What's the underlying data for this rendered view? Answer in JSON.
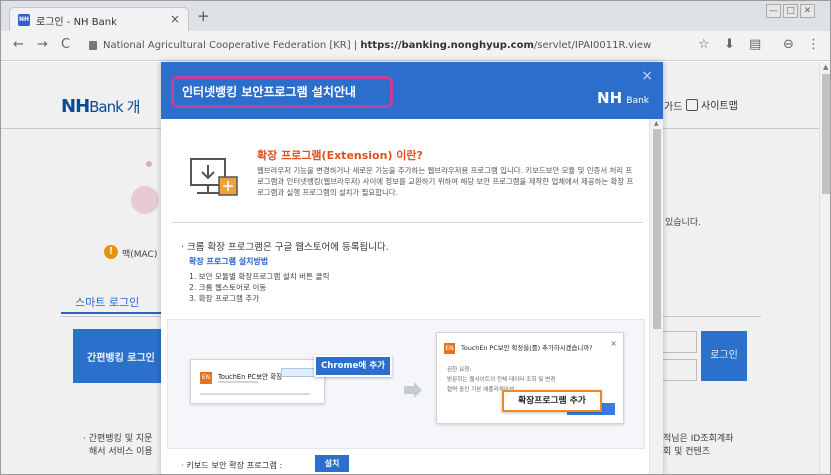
{
  "browser": {
    "tab_title": "로그인 - NH Bank",
    "tab_close": "×",
    "new_tab": "+",
    "url_prefix": "National Agricultural Cooperative Federation [KR]",
    "url_separator": "|",
    "url_host": "https://banking.nonghyup.com",
    "url_path": "/servlet/IPAI0011R.view",
    "back": "←",
    "forward": "→",
    "reload": "C",
    "star": "☆",
    "download": "⬇",
    "extensions": "▤",
    "profile": "⊖",
    "menu": "⋮",
    "win_min": "—",
    "win_max": "□",
    "win_close": "✕"
  },
  "page": {
    "logo_main": "NH",
    "logo_sub": "Bank 개",
    "header_partial": "가드",
    "sitemap_label": "사이트맵",
    "notice_partial": "있습니다.",
    "mac_partial": "맥(MAC)",
    "smart_login_tab": "스마트 로그인",
    "easy_banking_button": "간편뱅킹 로그인",
    "login_button": "로그인",
    "footer_left_1": "· 간편뱅킹 및 지문",
    "footer_left_2": "해서 서비스 이용",
    "footer_right_1": "적님은 ID조회계좌",
    "footer_right_2": "회 및 컨텐츠"
  },
  "modal": {
    "title": "인터넷뱅킹 보안프로그램 설치안내",
    "brand": "NH",
    "brand_sub": "Bank",
    "close": "×",
    "ext_heading": "확장 프로그램(Extension) 이란?",
    "ext_description": "웹브라우저 기능을 변경하거나 새로운 기능을 추가하는 웹브라우저용 프로그램 입니다. 키보드보안 모듈 및 인증서 처리 프로그램과 인터넷뱅킹(웹브라우저) 사이에 정보를 교환하기 위하여 해당 보안 프로그램을 제작한 업체에서 제공하는 확장 프로그램과 실행 프로그램의 설치가 필요합니다.",
    "register_title": "· 크롬 확장 프로그램은 구글 웹스토어에 등록됩니다.",
    "howto_title": "확장 프로그램 설치방법",
    "steps": [
      "1. 보안 모듈별 확장프로그램 설치 버튼 클릭",
      "2. 크롬 웹스토어로 이동",
      "3. 확장 프로그램 추가"
    ],
    "demo_card_name": "TouchEn PC보안 확장",
    "demo_card_icon": "EN",
    "demo_chrome_add": "Chrome에 추가",
    "demo_dialog_title": "TouchEn PC보안 확장을(를) 추가하시겠습니까?",
    "demo_dialog_close": "×",
    "demo_dialog_perm_title": "권한 요청:",
    "demo_dialog_perm_1": "방문하는 웹사이트의 전체 데이터 조회 및 변경",
    "demo_dialog_perm_2": "협력 중인 기본 애플리케이션",
    "demo_ext_add": "확장프로그램 추가",
    "keyboard_label": "· 키보드 보안 확장 프로그램 :",
    "install_button": "설치"
  },
  "colors": {
    "modal_header": "#2c6ecb",
    "title_highlight": "#c23fa0",
    "ext_heading": "#e0501b",
    "ext_add_border": "#ef8a1c",
    "nh_blue": "#0a4fa2"
  }
}
